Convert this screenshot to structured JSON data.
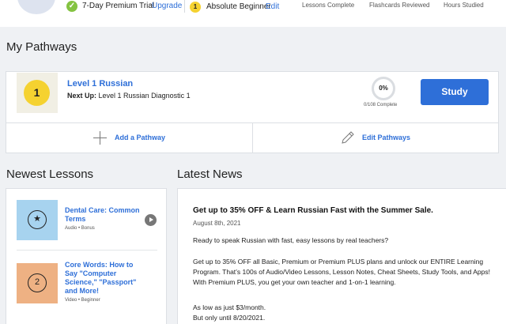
{
  "header": {
    "trial_label": "7-Day Premium Trial",
    "upgrade_label": "Upgrade",
    "level_badge": "1",
    "level_label": "Absolute Beginner",
    "edit_label": "Edit",
    "stats": [
      "Lessons Complete",
      "Flashcards Reviewed",
      "Hours Studied"
    ]
  },
  "pathways": {
    "section_title": "My Pathways",
    "level_number": "1",
    "course_name": "Level 1 Russian",
    "next_up_label": "Next Up:",
    "next_up_value": "Level 1 Russian Diagnostic 1",
    "progress_percent": "0%",
    "progress_text": "0/108 Complete",
    "study_label": "Study",
    "add_label": "Add a Pathway",
    "edit_label": "Edit Pathways"
  },
  "lessons": {
    "section_title": "Newest Lessons",
    "items": [
      {
        "title": "Dental Care: Common Terms",
        "meta": "Audio • Bonus",
        "icon": "star-icon",
        "thumb_color": "#a7d3ef"
      },
      {
        "title": "Core Words: How to Say \"Computer Science,\" \"Passport\" and More!",
        "meta": "Video • Beginner",
        "icon_text": "2",
        "thumb_color": "#eeb183"
      }
    ]
  },
  "news": {
    "section_title": "Latest News",
    "headline": "Get up to 35% OFF & Learn Russian Fast with the Summer Sale.",
    "date": "August 8th, 2021",
    "p1": "Ready to speak Russian with fast, easy lessons by real teachers?",
    "p2": "Get up to 35% OFF all Basic, Premium or Premium PLUS plans and unlock our ENTIRE Learning Program. That’s 100s of Audio/Video Lessons, Lesson Notes, Cheat Sheets, Study Tools, and Apps! With Premium PLUS, you get your own teacher and 1-on-1 learning.",
    "p3": "As low as just $3/month.",
    "p4": "But only until 8/20/2021."
  },
  "colors": {
    "accent": "#2e6fd8",
    "level_yellow": "#f5d230",
    "trial_green": "#84c341"
  }
}
